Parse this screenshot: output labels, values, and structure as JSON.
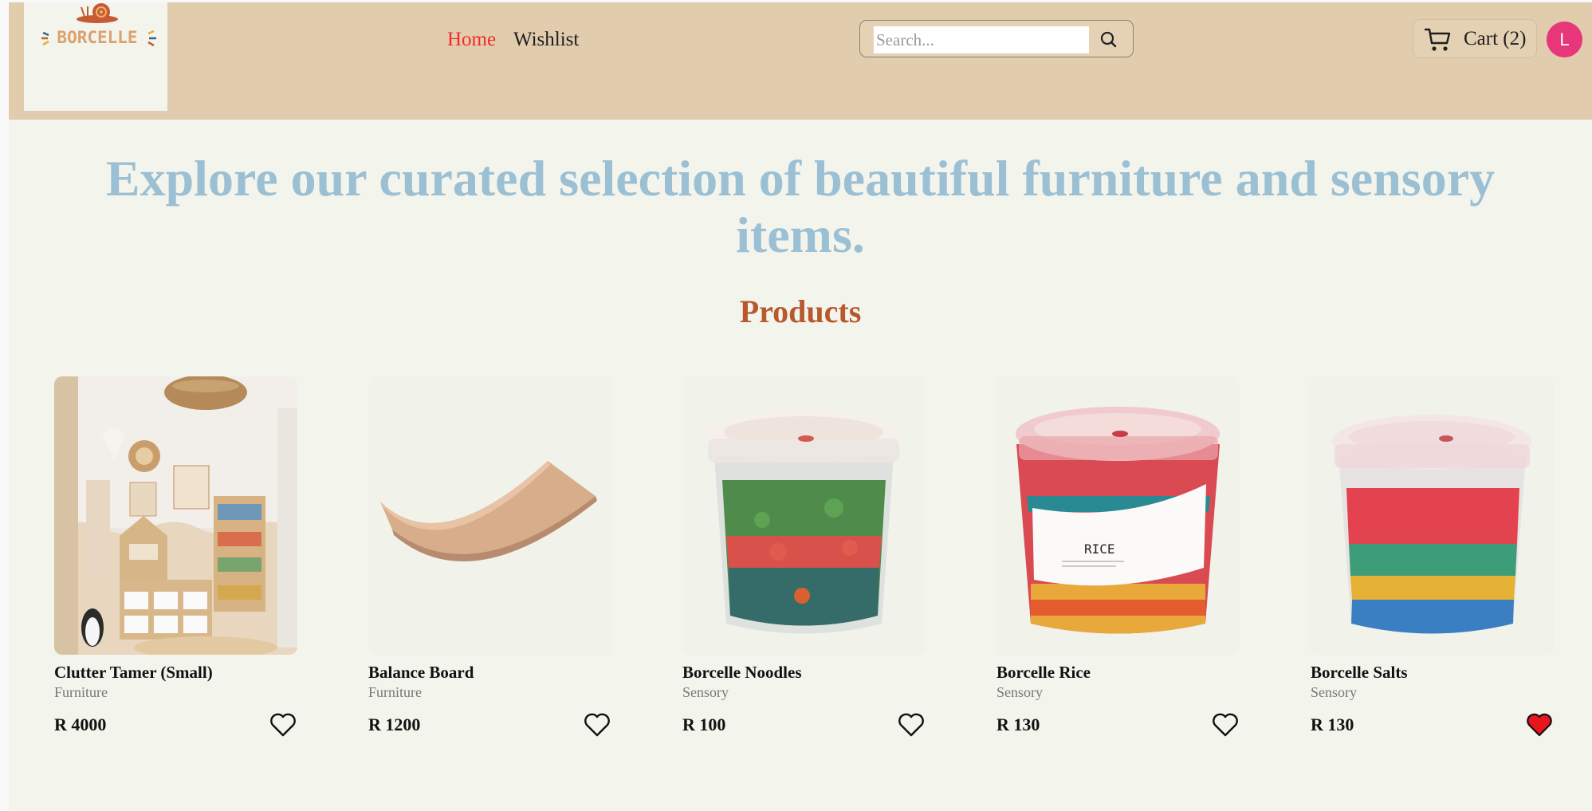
{
  "brand": {
    "logo_text": "BORCELLE"
  },
  "nav": {
    "home": "Home",
    "wishlist": "Wishlist"
  },
  "search": {
    "placeholder": "Search..."
  },
  "cart": {
    "label": "Cart (2)"
  },
  "user": {
    "initial": "L"
  },
  "hero": {
    "headline": "Explore our curated selection of beautiful furniture and sensory items."
  },
  "products_section": {
    "title": "Products"
  },
  "products": [
    {
      "name": "Clutter Tamer (Small)",
      "category": "Furniture",
      "price": "R 4000",
      "wishlisted": false
    },
    {
      "name": "Balance Board",
      "category": "Furniture",
      "price": "R 1200",
      "wishlisted": false
    },
    {
      "name": "Borcelle Noodles",
      "category": "Sensory",
      "price": "R 100",
      "wishlisted": false
    },
    {
      "name": "Borcelle Rice",
      "category": "Sensory",
      "price": "R 130",
      "wishlisted": false,
      "jar_label": "RICE"
    },
    {
      "name": "Borcelle Salts",
      "category": "Sensory",
      "price": "R 130",
      "wishlisted": true
    }
  ],
  "colors": {
    "header_bg": "#e1ccad",
    "page_bg": "#f3f4ec",
    "nav_active": "#f42a2a",
    "hero_text": "#9bc0d4",
    "section_title": "#b8582f",
    "avatar": "#e8367a",
    "heart_active": "#e8141e"
  },
  "icons": {
    "search": "magnifier-icon",
    "cart": "shopping-cart-icon",
    "wishlist": "heart-icon"
  }
}
